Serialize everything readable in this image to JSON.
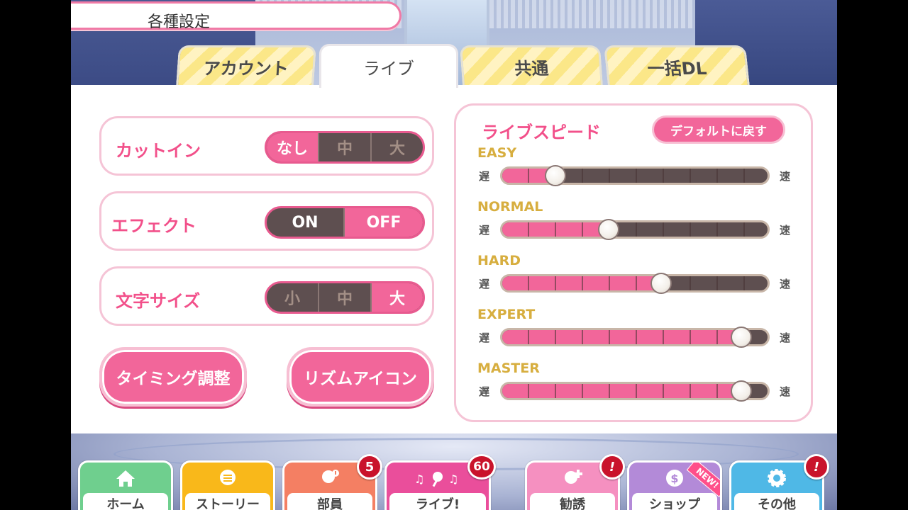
{
  "header": {
    "title": "各種設定"
  },
  "tabs": [
    {
      "label": "アカウント",
      "active": false
    },
    {
      "label": "ライブ",
      "active": true
    },
    {
      "label": "共通",
      "active": false
    },
    {
      "label": "一括DL",
      "active": false
    }
  ],
  "options": {
    "cutin": {
      "label": "カットイン",
      "choices": [
        "なし",
        "中",
        "大"
      ],
      "selected": "なし"
    },
    "effect": {
      "label": "エフェクト",
      "choices": [
        "ON",
        "OFF"
      ],
      "selected": "OFF"
    },
    "text_size": {
      "label": "文字サイズ",
      "choices": [
        "小",
        "中",
        "大"
      ],
      "selected": "大"
    }
  },
  "buttons": {
    "timing": "タイミング調整",
    "rhythm_icon": "リズムアイコン"
  },
  "live_speed": {
    "title": "ライブスピード",
    "reset_label": "デフォルトに戻す",
    "slow_label": "遅",
    "fast_label": "速",
    "steps": 10,
    "difficulties": [
      {
        "name": "EASY",
        "level": 2
      },
      {
        "name": "NORMAL",
        "level": 4
      },
      {
        "name": "HARD",
        "level": 6
      },
      {
        "name": "EXPERT",
        "level": 9
      },
      {
        "name": "MASTER",
        "level": 9
      }
    ]
  },
  "nav": {
    "home": {
      "label": "ホーム",
      "icon": "home-icon"
    },
    "story": {
      "label": "ストーリー",
      "icon": "chat-icon"
    },
    "member": {
      "label": "部員",
      "icon": "member-icon",
      "badge": "5"
    },
    "live": {
      "label": "ライブ!",
      "icon": "music-icon",
      "badge": "60"
    },
    "recruit": {
      "label": "勧誘",
      "icon": "recruit-icon",
      "badge": "!"
    },
    "shop": {
      "label": "ショップ",
      "icon": "coin-icon",
      "ribbon": "NEW!"
    },
    "other": {
      "label": "その他",
      "icon": "gear-icon",
      "badge": "!"
    }
  },
  "colors": {
    "accent": "#f2669a",
    "gold": "#d7ae3f",
    "dark": "#5e4f50"
  }
}
